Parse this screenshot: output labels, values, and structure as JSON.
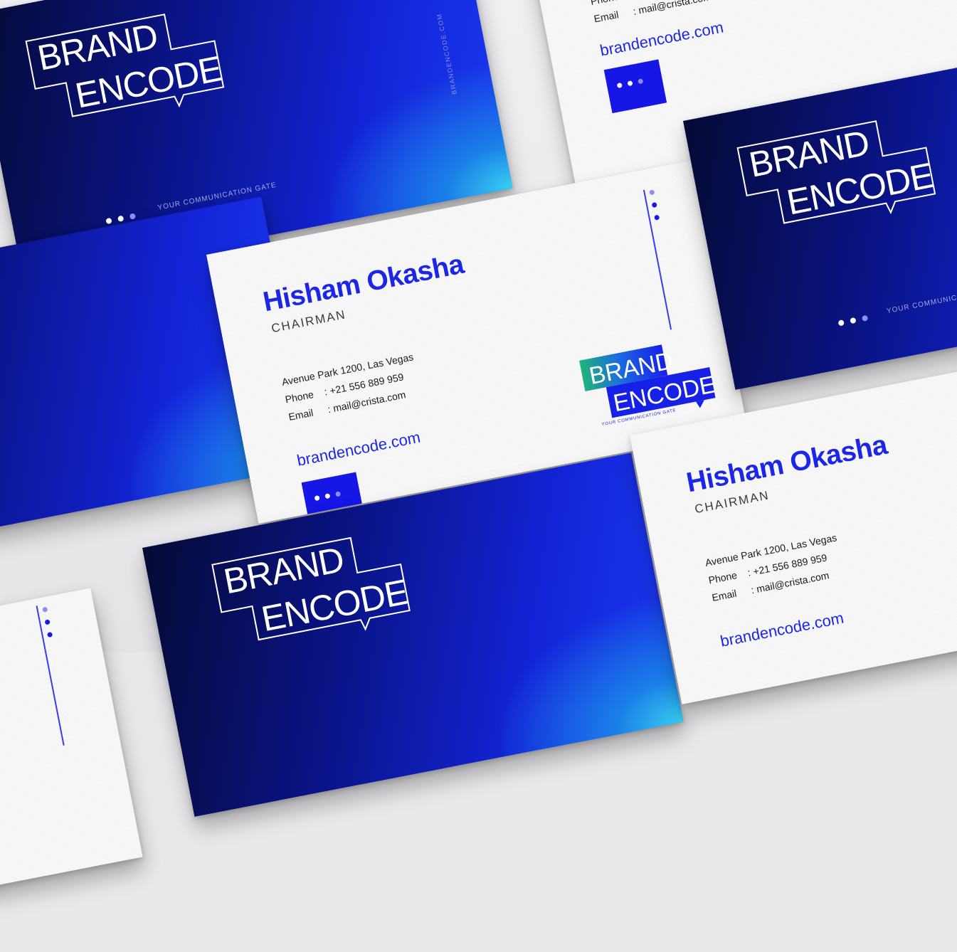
{
  "brand": {
    "line1": "BRAND",
    "line2": "ENCODE",
    "tagline": "YOUR COMMUNICATION GATE",
    "vertical_url": "BRANDENCODE.COM"
  },
  "person": {
    "name": "Hisham Okasha",
    "title": "CHAIRMAN"
  },
  "contact": {
    "address": "Avenue Park 1200, Las Vegas",
    "phone_label": "Phone",
    "phone_value": ": +21 556 889 959",
    "email_label": "Email",
    "email_value": ": mail@crista.com",
    "website": "brandencode.com"
  },
  "colors": {
    "brand_blue": "#1c26e8",
    "deep_navy": "#050a35",
    "cyan_glow": "#39d0f2",
    "paper": "#f7f7f8"
  }
}
